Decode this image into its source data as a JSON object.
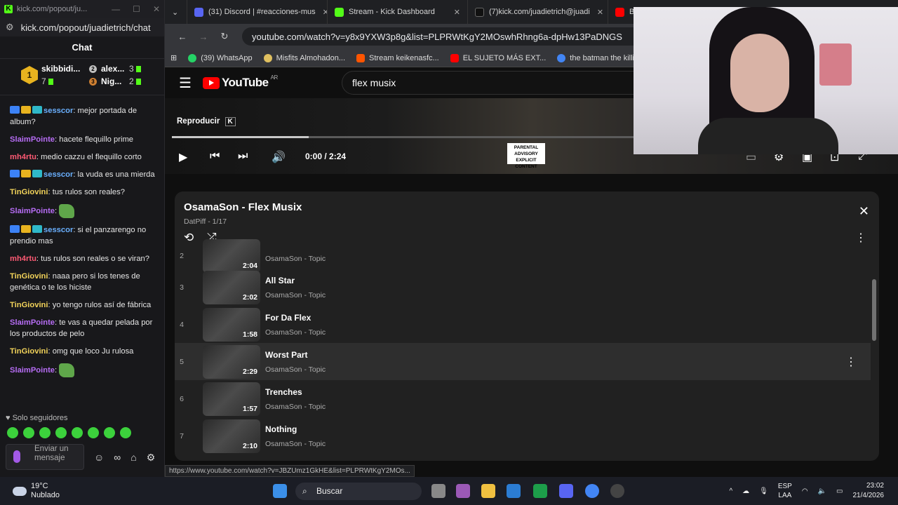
{
  "kick": {
    "window_title": "kick.com/popout/ju...",
    "url": "kick.com/popout/juadietrich/chat",
    "chat_title": "Chat",
    "leaderboard": [
      {
        "name": "skibbidi...",
        "count": "7",
        "rank": "1"
      },
      {
        "name": "alex...",
        "count": "3",
        "rank": "2"
      },
      {
        "name": "Nig...",
        "count": "2",
        "rank": "3"
      }
    ],
    "messages": [
      {
        "user": "sesscor",
        "color": "#6ab0ff",
        "text": "mejor portada de album?",
        "badges": true
      },
      {
        "user": "SlaimPointe",
        "color": "#b76df5",
        "text": "hacete flequillo prime",
        "badges": false
      },
      {
        "user": "mh4rtu",
        "color": "#ff5a74",
        "text": "medio cazzu el flequillo corto",
        "badges": false
      },
      {
        "user": "sesscor",
        "color": "#6ab0ff",
        "text": "la vuda es una mierda",
        "badges": true
      },
      {
        "user": "TinGiovini",
        "color": "#f2d35a",
        "text": "tus rulos son reales?",
        "badges": false
      },
      {
        "user": "SlaimPointe",
        "color": "#b76df5",
        "text": "",
        "badges": false,
        "emote": true
      },
      {
        "user": "sesscor",
        "color": "#6ab0ff",
        "text": "si el panzarengo no prendio mas",
        "badges": true
      },
      {
        "user": "mh4rtu",
        "color": "#ff5a74",
        "text": "tus rulos son reales o se viran?",
        "badges": false
      },
      {
        "user": "TinGiovini",
        "color": "#f2d35a",
        "text": "naaa pero si los tenes de genética o te los hiciste",
        "badges": false
      },
      {
        "user": "TinGiovini",
        "color": "#f2d35a",
        "text": "yo tengo rulos así de fábrica",
        "badges": false
      },
      {
        "user": "SlaimPointe",
        "color": "#b76df5",
        "text": "te vas a quedar pelada por los productos de pelo",
        "badges": false
      },
      {
        "user": "TinGiovini",
        "color": "#f2d35a",
        "text": "omg que loco Ju rulosa",
        "badges": false
      },
      {
        "user": "SlaimPointe",
        "color": "#b76df5",
        "text": "",
        "badges": false,
        "emote": true
      }
    ],
    "followers_only": "Solo seguidores",
    "input_placeholder": "Enviar un mensaje",
    "accent": "#53fc18"
  },
  "browser": {
    "tabs": [
      {
        "label": "(31) Discord | #reacciones-mus",
        "color": "#5865f2"
      },
      {
        "label": "Stream - Kick Dashboard",
        "color": "#53fc18"
      },
      {
        "label": "(7)kick.com/juadietrich@juadi",
        "color": "#111111"
      },
      {
        "label": "Blo",
        "color": "#ff0000"
      }
    ],
    "url": "youtube.com/watch?v=y8x9YXW3p8g&list=PLPRWtKgY2MOswhRhng6a-dpHw13PaDNGS",
    "bookmarks": [
      {
        "label": "(39) WhatsApp",
        "color": "#25d366"
      },
      {
        "label": "Misfits Almohadon...",
        "color": "#e0c060"
      },
      {
        "label": "Stream keikenasfc...",
        "color": "#ff5500"
      },
      {
        "label": "EL SUJETO MÁS EXT...",
        "color": "#ff0000"
      },
      {
        "label": "the batman the killi...",
        "color": "#4285f4"
      }
    ],
    "status_url": "https://www.youtube.com/watch?v=JBZUmz1GkHE&list=PLPRWtKgY2MOs..."
  },
  "youtube": {
    "logo": "YouTube",
    "country": "AR",
    "search_value": "flex musix",
    "reproducir": "Reproducir",
    "shortcut": "K",
    "time": "0:00 / 2:24",
    "advisory": "PARENTAL ADVISORY EXPLICIT CONTENT",
    "playlist": {
      "title": "OsamaSon - Flex Musix",
      "subtitle": "DatPiff - 1/17",
      "items": [
        {
          "index": "2",
          "title": "",
          "artist": "OsamaSon - Topic",
          "duration": "2:04"
        },
        {
          "index": "3",
          "title": "All Star",
          "artist": "OsamaSon - Topic",
          "duration": "2:02"
        },
        {
          "index": "4",
          "title": "For Da Flex",
          "artist": "OsamaSon - Topic",
          "duration": "1:58"
        },
        {
          "index": "5",
          "title": "Worst Part",
          "artist": "OsamaSon - Topic",
          "duration": "2:29"
        },
        {
          "index": "6",
          "title": "Trenches",
          "artist": "OsamaSon - Topic",
          "duration": "1:57"
        },
        {
          "index": "7",
          "title": "Nothing",
          "artist": "OsamaSon - Topic",
          "duration": "2:10"
        }
      ]
    }
  },
  "taskbar": {
    "temp": "19°C",
    "weather": "Nublado",
    "search": "Buscar",
    "lang1": "ESP",
    "lang2": "LAA",
    "time": "23:02",
    "date": "21/4/2026"
  }
}
